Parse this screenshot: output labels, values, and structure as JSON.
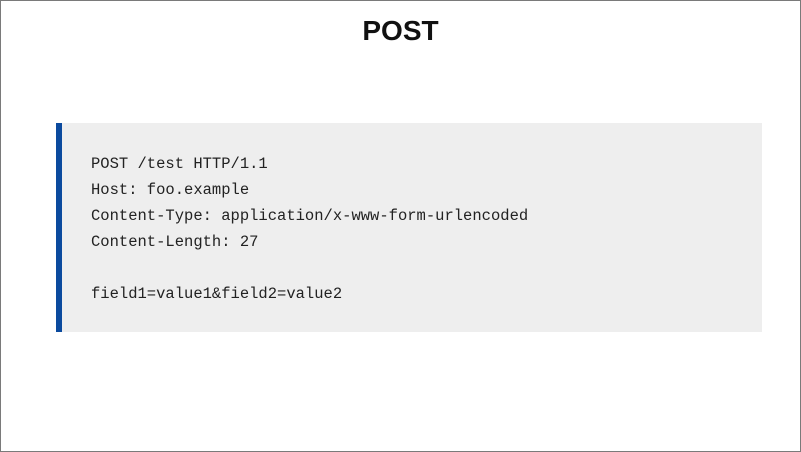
{
  "slide": {
    "title": "POST"
  },
  "code_block": {
    "lines": [
      "POST /test HTTP/1.1",
      "Host: foo.example",
      "Content-Type: application/x-www-form-urlencoded",
      "Content-Length: 27",
      "",
      "field1=value1&field2=value2"
    ]
  },
  "colors": {
    "accent_bar": "#0b4a9e",
    "code_background": "#eeeeee"
  }
}
